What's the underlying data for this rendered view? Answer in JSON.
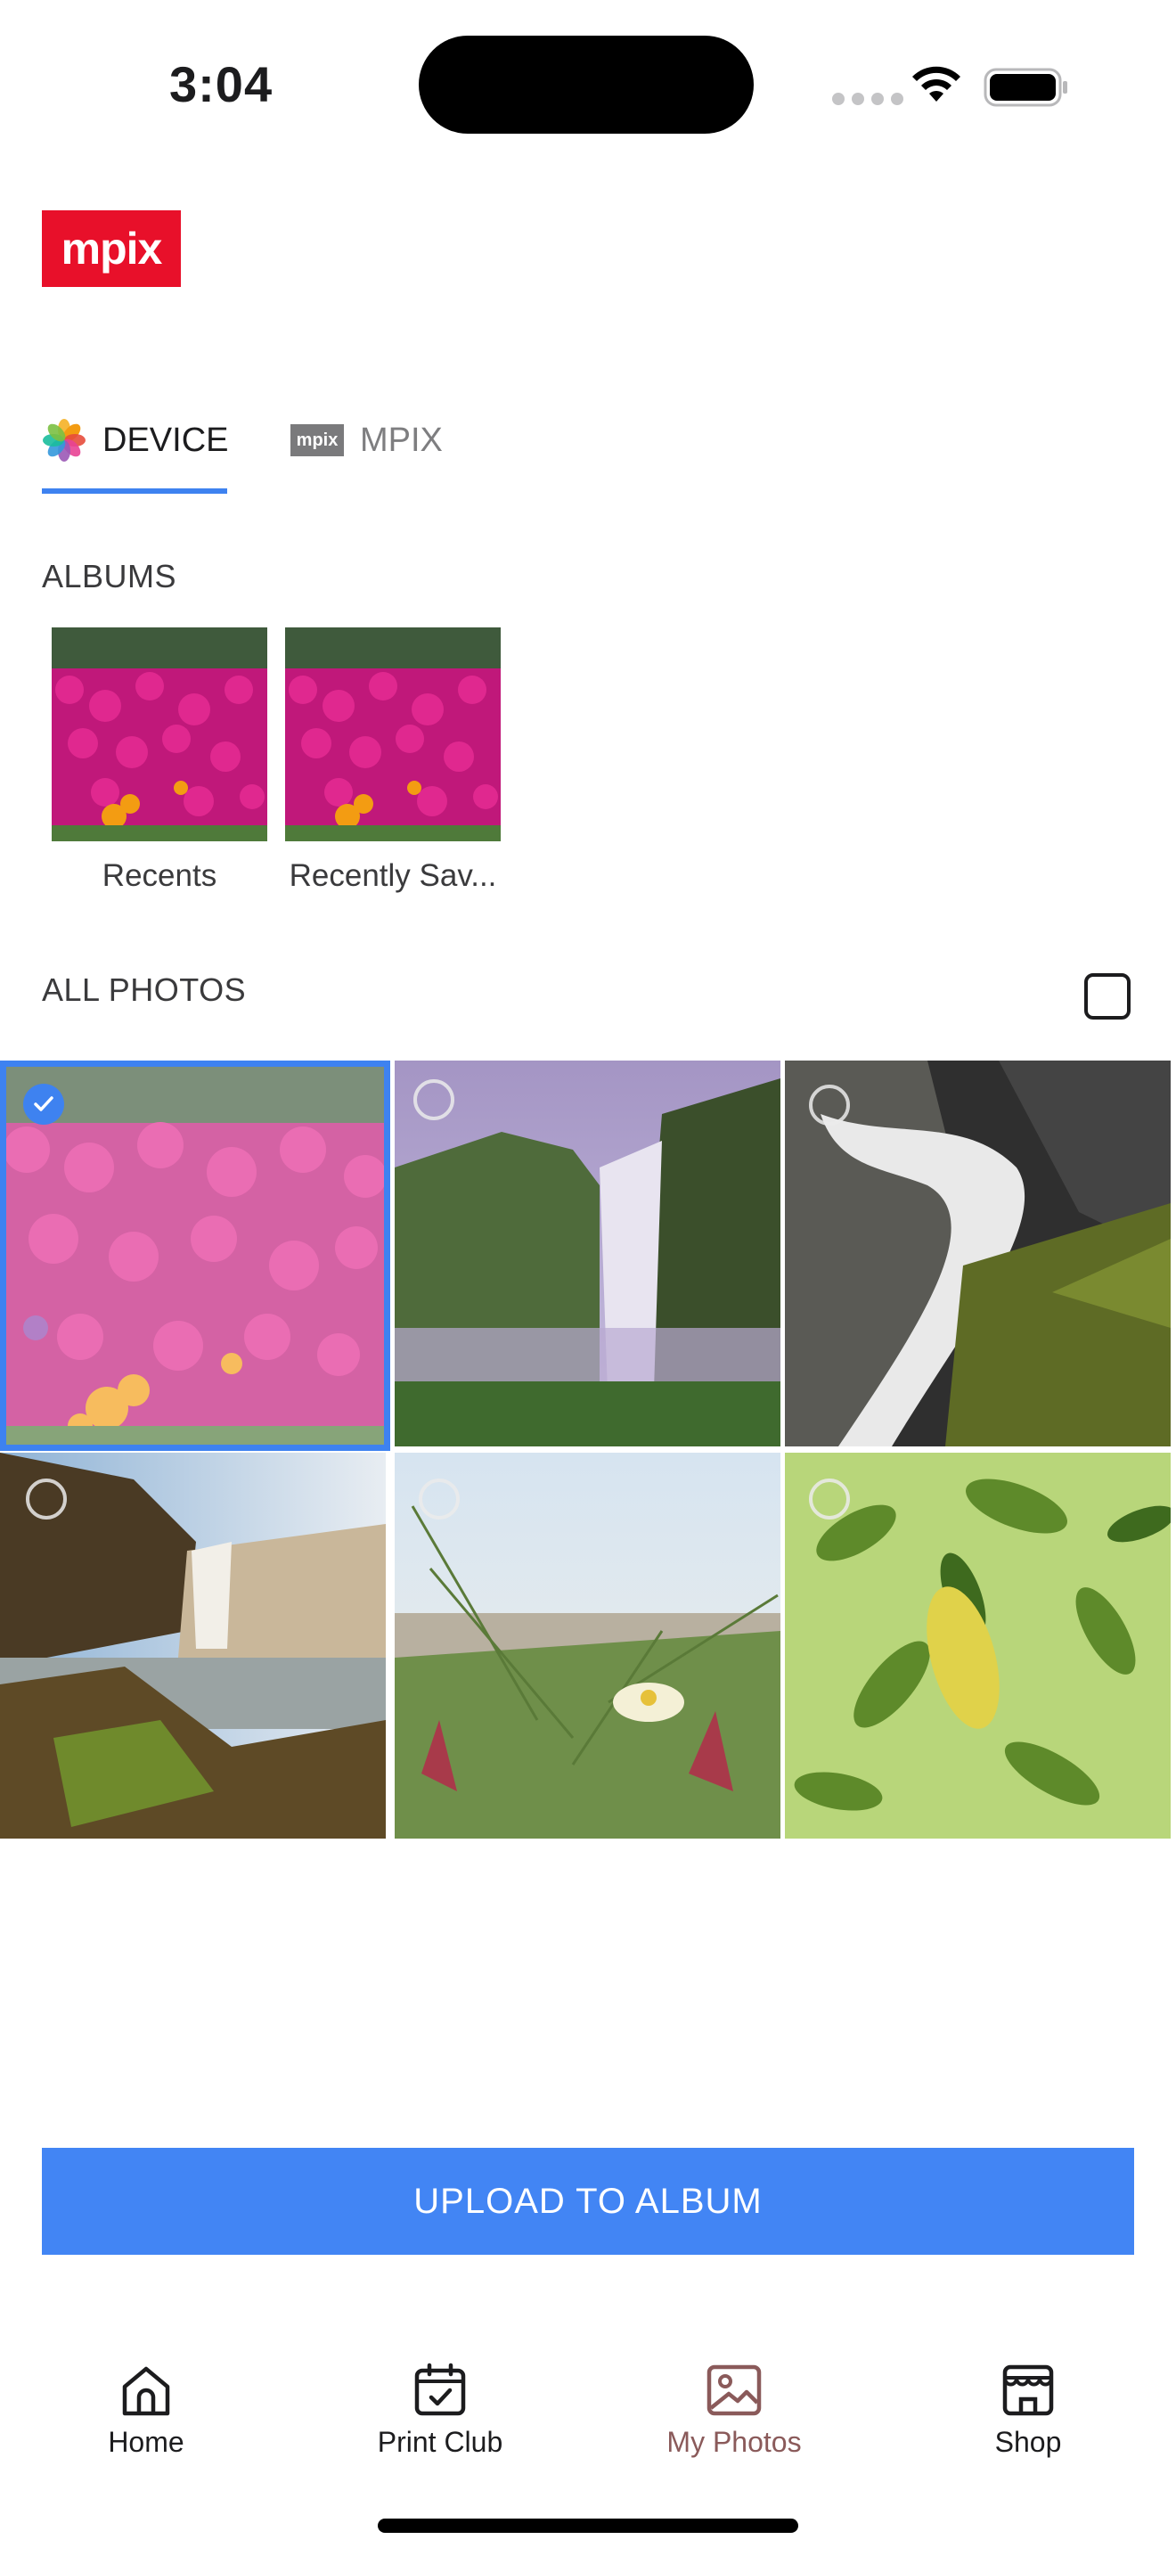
{
  "status_bar": {
    "time": "3:04"
  },
  "logo": {
    "text": "mpix"
  },
  "tabs": [
    {
      "label": "DEVICE",
      "icon": "photos-app-icon",
      "active": true
    },
    {
      "label": "MPIX",
      "icon": "mpix-badge-icon",
      "badge_text": "mpix",
      "active": false
    }
  ],
  "albums": {
    "title": "ALBUMS",
    "items": [
      {
        "label": "Recents"
      },
      {
        "label": "Recently Sav..."
      }
    ]
  },
  "all_photos": {
    "title": "ALL PHOTOS",
    "photos": [
      {
        "subject": "pink flowers",
        "selected": true
      },
      {
        "subject": "waterfall cliff",
        "selected": false
      },
      {
        "subject": "waterfall rocks",
        "selected": false
      },
      {
        "subject": "waterfall meadow",
        "selected": false
      },
      {
        "subject": "grass flower",
        "selected": false
      },
      {
        "subject": "green leaves",
        "selected": false
      }
    ]
  },
  "upload_button": {
    "label": "UPLOAD TO ALBUM"
  },
  "nav": [
    {
      "label": "Home",
      "icon": "home-icon",
      "active": false
    },
    {
      "label": "Print Club",
      "icon": "calendar-check-icon",
      "active": false
    },
    {
      "label": "My Photos",
      "icon": "photo-icon",
      "active": true
    },
    {
      "label": "Shop",
      "icon": "storefront-icon",
      "active": false
    }
  ],
  "colors": {
    "accent": "#4285f4",
    "brand": "#e8102a",
    "nav_active": "#8a5a5a"
  }
}
